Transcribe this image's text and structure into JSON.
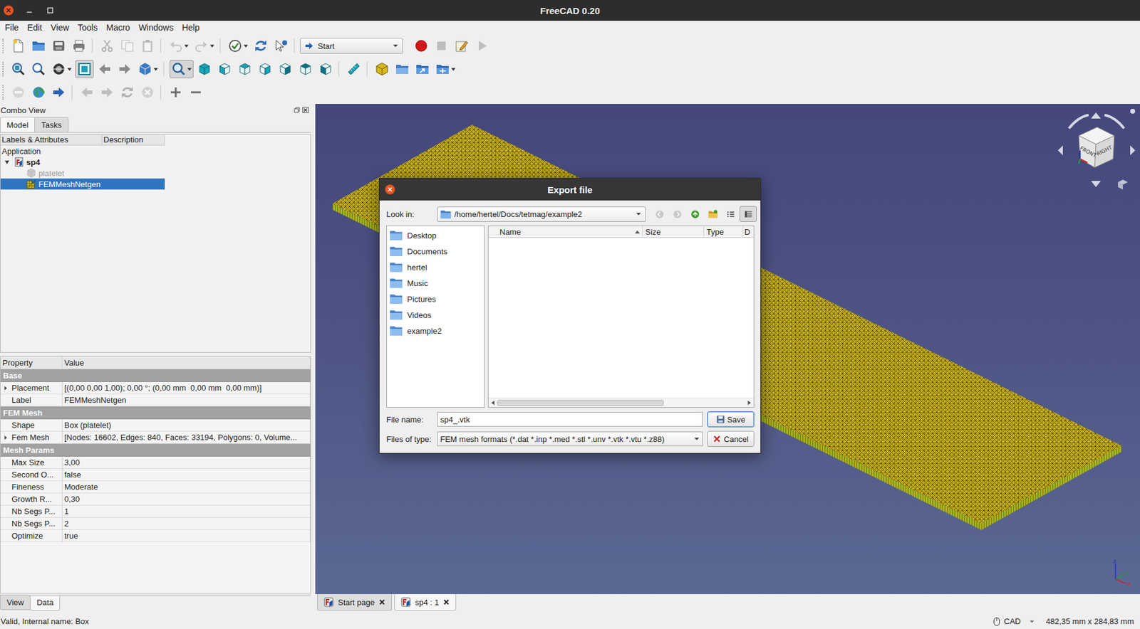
{
  "window": {
    "title": "FreeCAD 0.20"
  },
  "menu": [
    "File",
    "Edit",
    "View",
    "Tools",
    "Macro",
    "Windows",
    "Help"
  ],
  "toolbars": [
    [
      {
        "buttons": [
          {
            "kind": "new",
            "disabled": false,
            "selected": false,
            "dropdown": false
          },
          {
            "kind": "open",
            "disabled": false,
            "selected": false,
            "dropdown": false
          },
          {
            "kind": "save",
            "disabled": false,
            "selected": false,
            "dropdown": false
          },
          {
            "kind": "print",
            "disabled": false,
            "selected": false,
            "dropdown": false
          }
        ]
      },
      {
        "buttons": [
          {
            "kind": "cut",
            "disabled": true,
            "selected": false,
            "dropdown": false
          },
          {
            "kind": "copy",
            "disabled": true,
            "selected": false,
            "dropdown": false
          },
          {
            "kind": "paste",
            "disabled": true,
            "selected": false,
            "dropdown": false
          }
        ]
      },
      {
        "buttons": [
          {
            "kind": "undo",
            "disabled": true,
            "selected": false,
            "dropdown": true
          },
          {
            "kind": "redo",
            "disabled": true,
            "selected": false,
            "dropdown": true
          }
        ]
      },
      {
        "buttons": [
          {
            "kind": "macro-check",
            "disabled": false,
            "selected": false,
            "dropdown": true
          },
          {
            "kind": "refresh",
            "disabled": false,
            "selected": false,
            "dropdown": false
          },
          {
            "kind": "whats-this",
            "disabled": false,
            "selected": false,
            "dropdown": false
          }
        ]
      },
      {
        "combo": "Start",
        "buttons": [
          {
            "kind": "record",
            "disabled": false,
            "selected": false,
            "dropdown": false
          },
          {
            "kind": "stop",
            "disabled": true,
            "selected": false,
            "dropdown": false
          },
          {
            "kind": "edit-macro",
            "disabled": false,
            "selected": false,
            "dropdown": false
          },
          {
            "kind": "play",
            "disabled": true,
            "selected": false,
            "dropdown": false
          }
        ]
      }
    ],
    [
      {
        "buttons": [
          {
            "kind": "fit-all",
            "disabled": false,
            "selected": false,
            "dropdown": false
          },
          {
            "kind": "fit-selection",
            "disabled": false,
            "selected": false,
            "dropdown": false
          },
          {
            "kind": "draw-style",
            "disabled": false,
            "selected": false,
            "dropdown": true
          },
          {
            "kind": "bounding-box",
            "disabled": false,
            "selected": true,
            "dropdown": false
          },
          {
            "kind": "back-view",
            "disabled": false,
            "selected": false,
            "dropdown": false
          },
          {
            "kind": "forward-view",
            "disabled": false,
            "selected": false,
            "dropdown": false
          },
          {
            "kind": "std-views",
            "disabled": false,
            "selected": false,
            "dropdown": true
          }
        ]
      },
      {
        "buttons": [
          {
            "kind": "zoom",
            "disabled": false,
            "selected": true,
            "dropdown": true
          },
          {
            "kind": "view-iso",
            "disabled": false,
            "selected": false,
            "dropdown": false
          },
          {
            "kind": "view-front",
            "disabled": false,
            "selected": false,
            "dropdown": false
          },
          {
            "kind": "view-top",
            "disabled": false,
            "selected": false,
            "dropdown": false
          },
          {
            "kind": "view-right",
            "disabled": false,
            "selected": false,
            "dropdown": false
          },
          {
            "kind": "view-rear",
            "disabled": false,
            "selected": false,
            "dropdown": false
          },
          {
            "kind": "view-bottom",
            "disabled": false,
            "selected": false,
            "dropdown": false
          },
          {
            "kind": "view-left",
            "disabled": false,
            "selected": false,
            "dropdown": false
          }
        ]
      },
      {
        "buttons": [
          {
            "kind": "measure",
            "disabled": false,
            "selected": false,
            "dropdown": false
          }
        ]
      },
      {
        "buttons": [
          {
            "kind": "part",
            "disabled": false,
            "selected": false,
            "dropdown": false
          },
          {
            "kind": "group",
            "disabled": false,
            "selected": false,
            "dropdown": false
          },
          {
            "kind": "link",
            "disabled": false,
            "selected": false,
            "dropdown": false
          },
          {
            "kind": "link-actions",
            "disabled": false,
            "selected": false,
            "dropdown": true
          }
        ]
      }
    ],
    [
      {
        "buttons": [
          {
            "kind": "stop-loading",
            "disabled": true,
            "selected": false,
            "dropdown": false
          },
          {
            "kind": "web-home",
            "disabled": false,
            "selected": false,
            "dropdown": false
          },
          {
            "kind": "web-go",
            "disabled": false,
            "selected": false,
            "dropdown": false
          }
        ]
      },
      {
        "buttons": [
          {
            "kind": "web-back",
            "disabled": true,
            "selected": false,
            "dropdown": false
          },
          {
            "kind": "web-forward",
            "disabled": true,
            "selected": false,
            "dropdown": false
          },
          {
            "kind": "web-refresh",
            "disabled": true,
            "selected": false,
            "dropdown": false
          },
          {
            "kind": "web-stop",
            "disabled": true,
            "selected": false,
            "dropdown": false
          }
        ]
      },
      {
        "buttons": [
          {
            "kind": "web-zoom-in",
            "disabled": false,
            "selected": false,
            "dropdown": false
          },
          {
            "kind": "web-zoom-out",
            "disabled": false,
            "selected": false,
            "dropdown": false
          }
        ]
      }
    ]
  ],
  "combo_view": {
    "title": "Combo View",
    "tabs": [
      {
        "label": "Model",
        "selected": true
      },
      {
        "label": "Tasks",
        "selected": false
      }
    ]
  },
  "tree": {
    "columns": [
      "Labels & Attributes",
      "Description"
    ],
    "items": [
      {
        "label": "Application",
        "kind": "application",
        "depth": 0,
        "expanded": false,
        "selected": false,
        "disabled": false,
        "active": false
      },
      {
        "label": "sp4",
        "kind": "document",
        "depth": 0,
        "expanded": true,
        "selected": false,
        "disabled": false,
        "active": true
      },
      {
        "label": "platelet",
        "kind": "box",
        "depth": 1,
        "expanded": false,
        "selected": false,
        "disabled": true,
        "active": false
      },
      {
        "label": "FEMMeshNetgen",
        "kind": "mesh",
        "depth": 1,
        "expanded": false,
        "selected": true,
        "disabled": false,
        "active": false
      }
    ]
  },
  "properties": {
    "columns": [
      "Property",
      "Value"
    ],
    "groups": [
      {
        "name": "Base",
        "rows": [
          {
            "name": "Placement",
            "value": "[(0,00 0,00 1,00); 0,00 °; (0,00 mm  0,00 mm  0,00 mm)]",
            "expandable": true
          },
          {
            "name": "Label",
            "value": "FEMMeshNetgen",
            "expandable": false
          }
        ]
      },
      {
        "name": "FEM Mesh",
        "rows": [
          {
            "name": "Shape",
            "value": "Box (platelet)",
            "expandable": false
          },
          {
            "name": "Fem Mesh",
            "value": "[Nodes: 16602, Edges: 840, Faces: 33194, Polygons: 0, Volume...",
            "expandable": true
          }
        ]
      },
      {
        "name": "Mesh Params",
        "rows": [
          {
            "name": "Max Size",
            "value": "3,00",
            "expandable": false
          },
          {
            "name": "Second O...",
            "value": "false",
            "expandable": false
          },
          {
            "name": "Fineness",
            "value": "Moderate",
            "expandable": false
          },
          {
            "name": "Growth R...",
            "value": "0,30",
            "expandable": false
          },
          {
            "name": "Nb Segs P...",
            "value": "1",
            "expandable": false
          },
          {
            "name": "Nb Segs P...",
            "value": "2",
            "expandable": false
          },
          {
            "name": "Optimize",
            "value": "true",
            "expandable": false
          }
        ]
      }
    ]
  },
  "panel_tabs": [
    {
      "label": "View",
      "selected": false
    },
    {
      "label": "Data",
      "selected": true
    }
  ],
  "viewport": {
    "navcube": {
      "faces": [
        "FRONT",
        "RIGHT"
      ]
    },
    "axes": [
      {
        "label": "z",
        "color": "#2233cc"
      },
      {
        "label": "y",
        "color": "#22a033"
      },
      {
        "label": "x",
        "color": "#cc2222"
      }
    ]
  },
  "doc_tabs": [
    {
      "label": "Start page",
      "selected": false
    },
    {
      "label": "sp4 : 1",
      "selected": true
    }
  ],
  "status_bar": {
    "message": "Valid, Internal name: Box",
    "navigation": "CAD",
    "dimensions": "482,35 mm x 284,83 mm"
  },
  "dialog": {
    "title": "Export file",
    "look_in_label": "Look in:",
    "path": "/home/hertel/Docs/tetmag/example2",
    "nav": [
      {
        "kind": "nav-back",
        "disabled": true
      },
      {
        "kind": "nav-forward",
        "disabled": true
      },
      {
        "kind": "nav-up",
        "disabled": false
      },
      {
        "kind": "new-folder",
        "disabled": false
      }
    ],
    "view_modes": [
      {
        "kind": "list-view",
        "selected": false
      },
      {
        "kind": "detail-view",
        "selected": true
      }
    ],
    "places": [
      "Desktop",
      "Documents",
      "hertel",
      "Music",
      "Pictures",
      "Videos",
      "example2"
    ],
    "columns": [
      {
        "label": "Name",
        "sorted": true
      },
      {
        "label": "Size",
        "sorted": false
      },
      {
        "label": "Type",
        "sorted": false
      },
      {
        "label": "D",
        "sorted": false
      }
    ],
    "file_name_label": "File name:",
    "file_name": "sp4_.vtk",
    "file_type_label": "Files of type:",
    "file_type": "FEM mesh formats (*.dat *.inp *.med *.stl *.unv *.vtk *.vtu *.z88)",
    "buttons": [
      {
        "label": "Save",
        "kind": "save",
        "default": true
      },
      {
        "label": "Cancel",
        "kind": "cancel",
        "default": false
      }
    ]
  }
}
